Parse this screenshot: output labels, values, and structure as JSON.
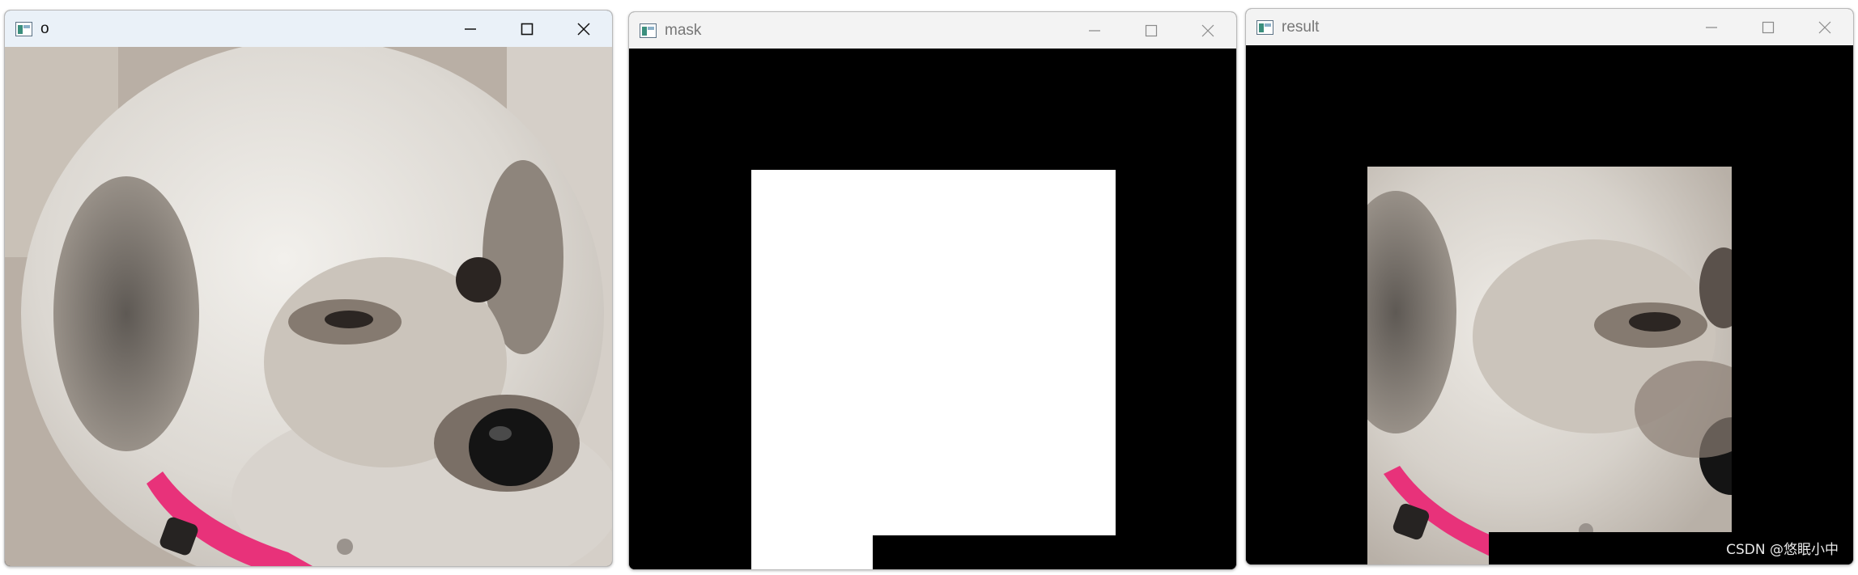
{
  "windows": [
    {
      "id": "original",
      "title": "o",
      "state": "active",
      "icons": {
        "app": "app-icon",
        "minimize": "minimize-icon",
        "maximize": "maximize-icon",
        "close": "close-icon"
      }
    },
    {
      "id": "mask",
      "title": "mask",
      "state": "inactive",
      "icons": {
        "app": "app-icon",
        "minimize": "minimize-icon",
        "maximize": "maximize-icon",
        "close": "close-icon"
      }
    },
    {
      "id": "result",
      "title": "result",
      "state": "inactive",
      "icons": {
        "app": "app-icon",
        "minimize": "minimize-icon",
        "maximize": "maximize-icon",
        "close": "close-icon"
      }
    }
  ],
  "watermark": "CSDN @悠眠小中",
  "colors": {
    "mask_fill": "#ffffff",
    "background": "#000000",
    "collar": "#e8327a",
    "fur_light": "#e4e1dc",
    "fur_dark": "#6a6460",
    "nose": "#141414",
    "ground": "#b8aea4"
  }
}
